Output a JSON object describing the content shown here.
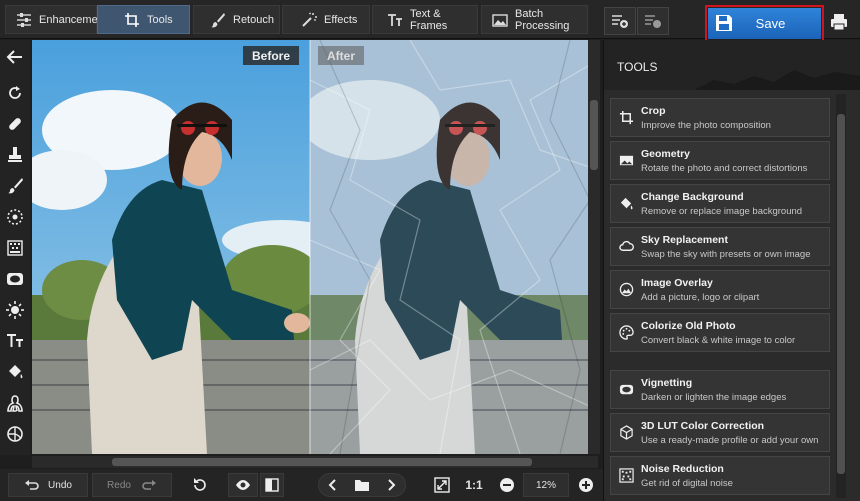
{
  "tabs": [
    {
      "label": "Enhancement",
      "icon": "sliders-icon",
      "active": false
    },
    {
      "label": "Tools",
      "icon": "crop-icon",
      "active": true
    },
    {
      "label": "Retouch",
      "icon": "brush-icon",
      "active": false
    },
    {
      "label": "Effects",
      "icon": "magic-wand-icon",
      "active": false
    },
    {
      "label": "Text & Frames",
      "icon": "text-icon",
      "active": false
    },
    {
      "label": "Batch Processing",
      "icon": "images-icon",
      "active": false
    }
  ],
  "toolbar": {
    "save_label": "Save"
  },
  "canvas": {
    "before_label": "Before",
    "after_label": "After"
  },
  "panel": {
    "title": "TOOLS",
    "items": [
      {
        "title": "Crop",
        "desc": "Improve the photo composition",
        "icon": "crop-icon"
      },
      {
        "title": "Geometry",
        "desc": "Rotate the photo and correct distortions",
        "icon": "image-icon"
      },
      {
        "title": "Change Background",
        "desc": "Remove or replace image background",
        "icon": "bucket-icon"
      },
      {
        "title": "Sky Replacement",
        "desc": "Swap the sky with presets or own image",
        "icon": "cloud-icon"
      },
      {
        "title": "Image Overlay",
        "desc": "Add a picture, logo or clipart",
        "icon": "overlay-icon"
      },
      {
        "title": "Colorize Old Photo",
        "desc": "Convert black & white image to color",
        "icon": "palette-icon"
      },
      {
        "title": "Vignetting",
        "desc": "Darken or lighten the image edges",
        "icon": "vignette-icon"
      },
      {
        "title": "3D LUT Color Correction",
        "desc": "Use a ready-made profile or add your own",
        "icon": "cube-icon"
      },
      {
        "title": "Noise Reduction",
        "desc": "Get rid of digital noise",
        "icon": "noise-icon"
      }
    ]
  },
  "bottom": {
    "undo_label": "Undo",
    "redo_label": "Redo",
    "ratio_label": "1:1",
    "zoom_value": "12%"
  },
  "colors": {
    "accent": "#2f84da",
    "active_tab": "#3e5670",
    "save_outline": "#d2141e"
  }
}
